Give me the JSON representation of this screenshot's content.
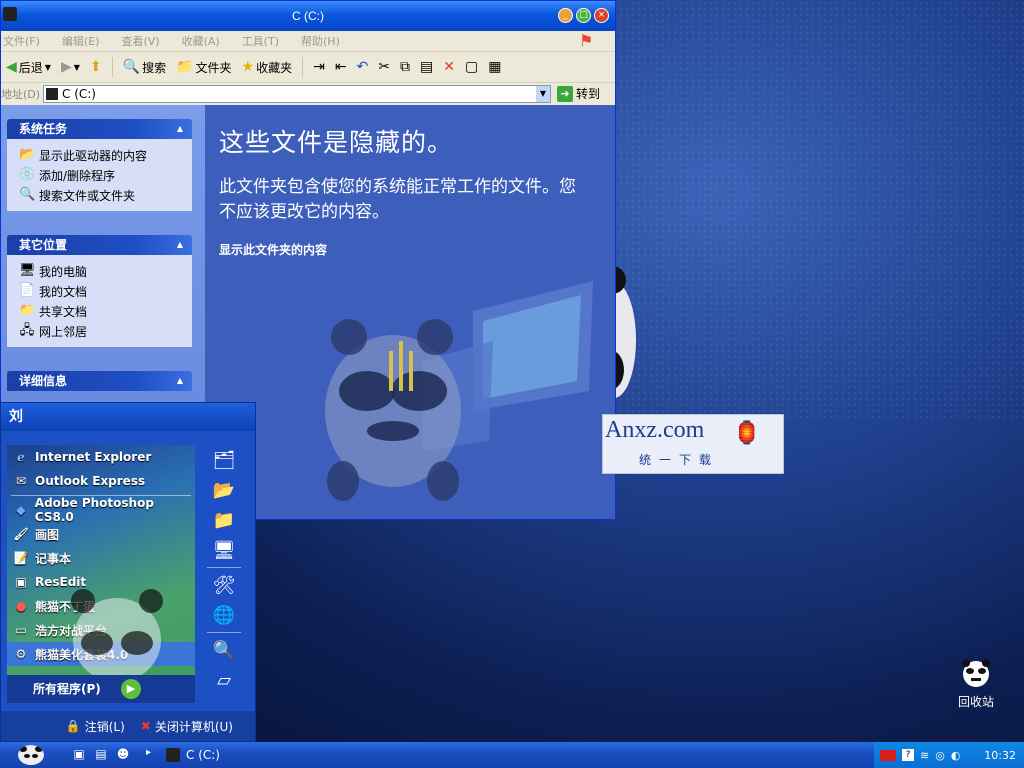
{
  "window": {
    "title": "C (C:)",
    "menu": [
      "文件(F)",
      "编辑(E)",
      "查看(V)",
      "收藏(A)",
      "工具(T)",
      "帮助(H)"
    ],
    "toolbar": {
      "back": "后退",
      "search": "搜索",
      "folders": "文件夹",
      "favorites": "收藏夹"
    },
    "address": {
      "label": "地址(D)",
      "value": "C (C:)",
      "go": "转到"
    },
    "tasks": {
      "system": {
        "title": "系统任务",
        "items": [
          "显示此驱动器的内容",
          "添加/删除程序",
          "搜索文件或文件夹"
        ]
      },
      "places": {
        "title": "其它位置",
        "items": [
          "我的电脑",
          "我的文档",
          "共享文档",
          "网上邻居"
        ]
      },
      "details": {
        "title": "详细信息"
      }
    },
    "content": {
      "heading": "这些文件是隐藏的。",
      "body": "此文件夹包含使您的系统能正常工作的文件。您不应该更改它的内容。",
      "link": "显示此文件夹的内容"
    }
  },
  "watermark": {
    "line1": "Anxz.com",
    "line2": "统一下载"
  },
  "start_menu": {
    "user": "刘",
    "items": [
      "Internet Explorer",
      "Outlook Express",
      "Adobe Photoshop CS8.0",
      "画图",
      "记事本",
      "ResEdit",
      "熊猫不丁蛋",
      "浩方对战平台",
      "熊猫美化套装4.0"
    ],
    "all_programs": "所有程序(P)",
    "logoff": "注销(L)",
    "shutdown": "关闭计算机(U)"
  },
  "taskbar": {
    "task": "C (C:)",
    "clock": "10:32"
  },
  "desktop": {
    "recycle_bin": "回收站"
  },
  "colors": {
    "accent": "#1d4fc5",
    "content_bg": "#3e5ebb",
    "task_header": "#1a3fa8"
  }
}
